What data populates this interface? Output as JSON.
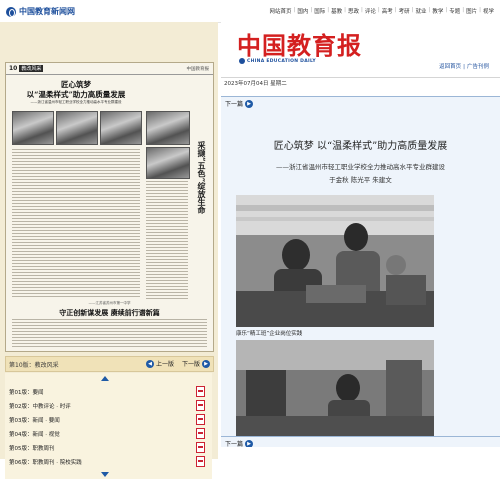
{
  "site": {
    "name": "中国教育新闻网",
    "nav": [
      "网站首页",
      "国内",
      "国际",
      "基教",
      "思政",
      "评论",
      "高考",
      "考研",
      "就业",
      "教学",
      "专题",
      "图片",
      "视学"
    ]
  },
  "paper_preview": {
    "page_number": "10",
    "section": "教改风采",
    "masthead": "中国教育报",
    "headline_line1": "匠心筑梦",
    "headline_line2": "以“温柔样式”助力高质量发展",
    "headline_sub": "——浙江省温州市轻工职业学校全力推动高水平专业群建设",
    "side_title": "采撷“五色”绽放生命",
    "bottom_sub": "——江苏省苏州市第一中学",
    "bottom_headline": "守正创新谋发展 赓续前行谱新篇"
  },
  "page_bar": {
    "label": "第10版：教改风采",
    "prev": "上一版",
    "next": "下一版"
  },
  "page_list": [
    "第01版：要闻",
    "第02版：中教评论 · 时评",
    "第03版：新闻 · 要闻",
    "第04版：新闻 · 视觉",
    "第05版：职教周刊",
    "第06版：职教周刊 · 院校实践"
  ],
  "newspaper": {
    "logo_cn": "中国教育报",
    "logo_en": "CHINA EDUCATION DAILY",
    "links": [
      "返回首页",
      "广告刊例"
    ],
    "date": "2023年07月04日 星期二",
    "next_article": "下一篇"
  },
  "article": {
    "title": "匠心筑梦 以“温柔样式”助力高质量发展",
    "subtitle": "——浙江省温州市轻工职业学校全力推动高水平专业群建设",
    "authors": "于金秋   陈光平   朱建文",
    "photo1_caption": "康乐“精工班”企业岗位实践"
  },
  "colors": {
    "brand_blue": "#1d4f9c",
    "logo_red": "#d42020",
    "left_bg": "#f3ecd5"
  }
}
